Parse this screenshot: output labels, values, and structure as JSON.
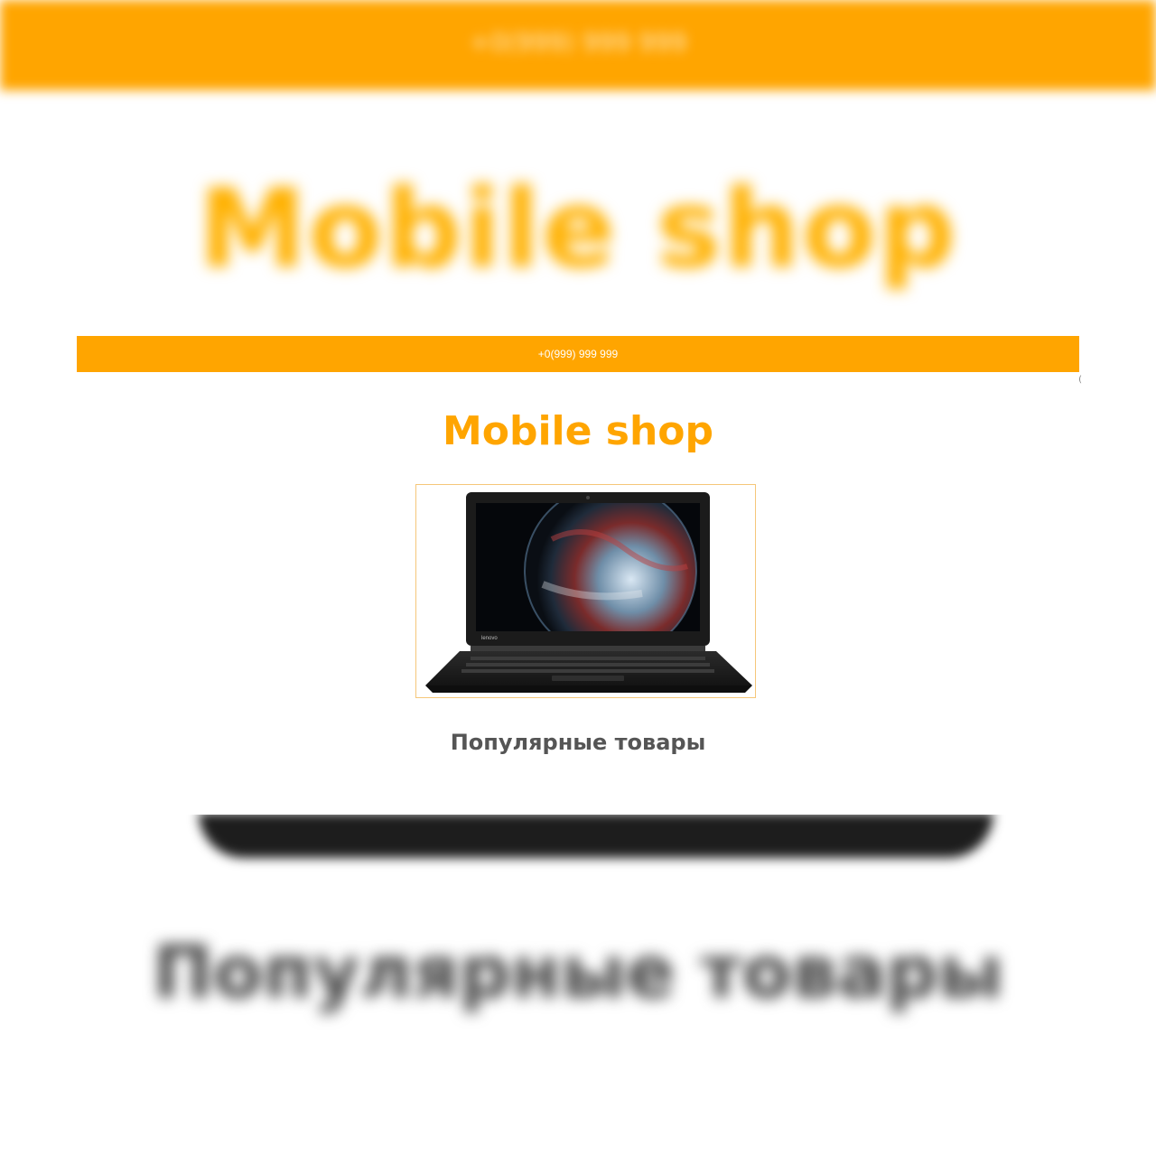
{
  "header": {
    "phone": "+0(999) 999 999"
  },
  "site": {
    "title": "Mobile shop"
  },
  "product_image": {
    "icon": "laptop-image",
    "brand_mark": "lenovo"
  },
  "sections": {
    "popular_title": "Популярные товары"
  },
  "colors": {
    "accent": "#ffa500",
    "frame_border": "#f5c77a",
    "heading_gray": "#555555"
  }
}
